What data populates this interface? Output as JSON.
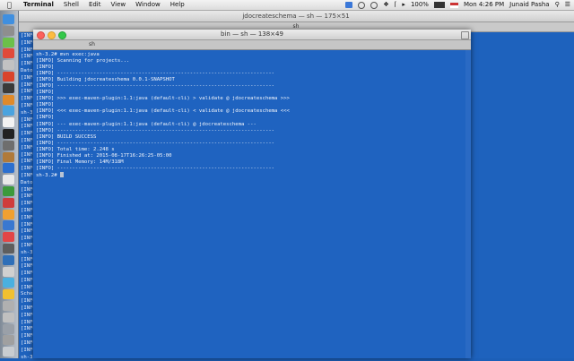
{
  "menubar": {
    "apple": "",
    "app_name": "Terminal",
    "menus": [
      "Shell",
      "Edit",
      "View",
      "Window",
      "Help"
    ],
    "battery": "100%",
    "clock": "Mon 4:26 PM",
    "user": "Junaid Pasha"
  },
  "back_window": {
    "title": "jdocreateschema — sh — 175×51",
    "tab": "sh",
    "lines": [
      "[INFO",
      "[INFO",
      "[INFO",
      "[INFO",
      "[INFO",
      "Dato",
      "[INFO",
      "[INFO",
      "[INFO",
      "[INFO",
      "[INFO",
      "sh-3",
      "[INFO",
      "[INFO",
      "[INFO",
      "[INFO",
      "[INFO",
      "[INFO",
      "[INFO",
      "[INFO",
      "[INFO",
      "Dato",
      "[INFO",
      "[INFO",
      "[INFO",
      "[INFO",
      "[INFO",
      "[INFO",
      "[INFO",
      "[INFO",
      "[INFO",
      "sh-3",
      "[INFO",
      "[INFO",
      "[INFO",
      "[INFO",
      "[INFO",
      "Sche",
      "[INFO",
      "[INFO",
      "[INFO",
      "[INFO",
      "[INFO",
      "[INFO",
      "[INFO",
      "[INFO",
      "sh-3"
    ]
  },
  "front_window": {
    "title": "bin — sh — 138×49",
    "tab": "sh",
    "lines": [
      "sh-3.2# mvn exec:java",
      "[INFO] Scanning for projects...",
      "[INFO]",
      "[INFO] ------------------------------------------------------------------------",
      "[INFO] Building jdocreateschema 0.0.1-SNAPSHOT",
      "[INFO] ------------------------------------------------------------------------",
      "[INFO]",
      "[INFO] >>> exec-maven-plugin:1.1:java (default-cli) > validate @ jdocreateschema >>>",
      "[INFO]",
      "[INFO] <<< exec-maven-plugin:1.1:java (default-cli) < validate @ jdocreateschema <<<",
      "[INFO]",
      "[INFO] --- exec-maven-plugin:1.1:java (default-cli) @ jdocreateschema ---",
      "[INFO] ------------------------------------------------------------------------",
      "[INFO] BUILD SUCCESS",
      "[INFO] ------------------------------------------------------------------------",
      "[INFO] Total time: 2.248 s",
      "[INFO] Finished at: 2015-08-17T16:26:25-05:00",
      "[INFO] Final Memory: 14M/318M",
      "[INFO] ------------------------------------------------------------------------"
    ],
    "prompt": "sh-3.2#"
  },
  "colors": {
    "terminal_bg": "#1f63c0",
    "terminal_text": "#f2f5fb"
  },
  "dock_icons": [
    "finder-icon",
    "app-icon",
    "app-icon",
    "app-icon",
    "app-icon",
    "app-icon",
    "app-icon",
    "app-icon",
    "app-icon",
    "app-icon",
    "app-icon",
    "app-icon",
    "app-icon",
    "app-icon",
    "app-icon",
    "app-icon",
    "app-icon",
    "app-icon",
    "app-icon",
    "app-icon",
    "app-icon",
    "app-icon",
    "app-icon",
    "app-icon",
    "app-icon",
    "app-icon",
    "app-icon",
    "app-icon",
    "app-icon",
    "trash-icon"
  ]
}
